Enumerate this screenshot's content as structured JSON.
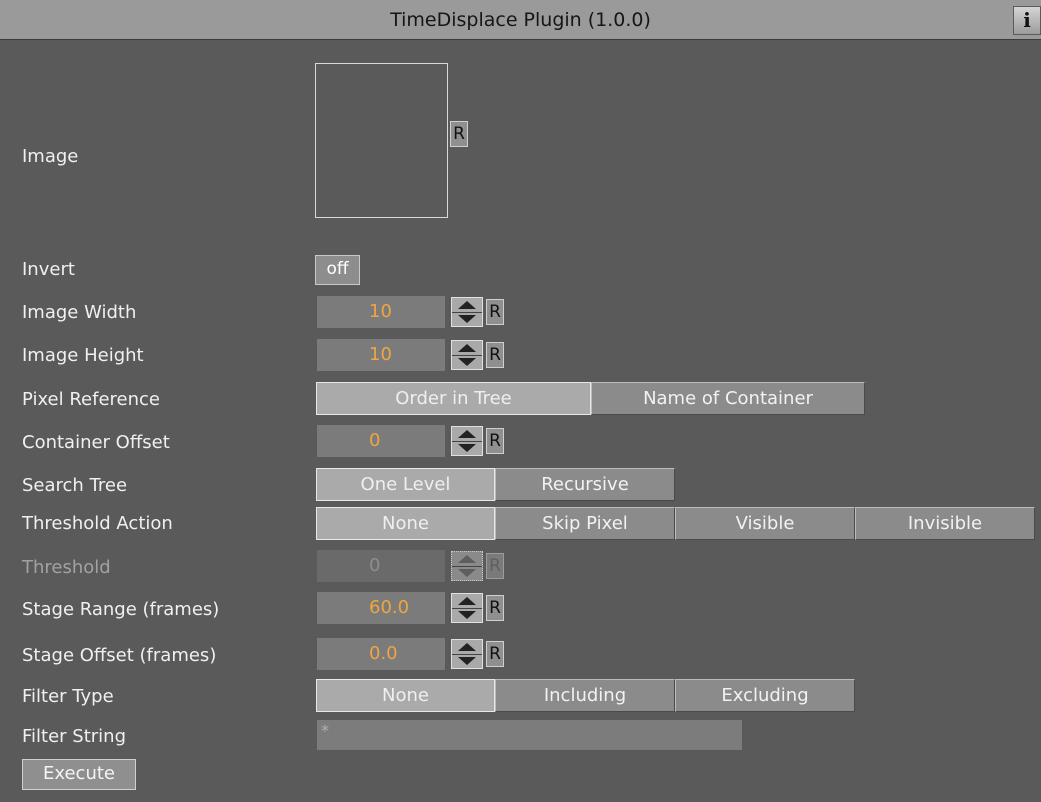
{
  "titlebar": {
    "title": "TimeDisplace Plugin (1.0.0)",
    "info_label": "i"
  },
  "labels": {
    "image": "Image",
    "invert": "Invert",
    "image_width": "Image Width",
    "image_height": "Image Height",
    "pixel_reference": "Pixel Reference",
    "container_offset": "Container Offset",
    "search_tree": "Search Tree",
    "threshold_action": "Threshold Action",
    "threshold": "Threshold",
    "stage_range": "Stage Range (frames)",
    "stage_offset": "Stage Offset (frames)",
    "filter_type": "Filter Type",
    "filter_string": "Filter String"
  },
  "reset_label": "R",
  "invert": {
    "value": "off"
  },
  "fields": {
    "image_width": "10",
    "image_height": "10",
    "container_offset": "0",
    "threshold": "0",
    "stage_range": "60.0",
    "stage_offset": "0.0"
  },
  "pixel_reference": {
    "options": [
      "Order in Tree",
      "Name of Container"
    ],
    "selected": "Order in Tree"
  },
  "search_tree": {
    "options": [
      "One Level",
      "Recursive"
    ],
    "selected": "One Level"
  },
  "threshold_action": {
    "options": [
      "None",
      "Skip Pixel",
      "Visible",
      "Invisible"
    ],
    "selected": "None"
  },
  "filter_type": {
    "options": [
      "None",
      "Including",
      "Excluding"
    ],
    "selected": "None"
  },
  "filter_string": {
    "value": "*"
  },
  "execute_label": "Execute",
  "colors": {
    "background": "#5a5a5a",
    "titlebar": "#9a9a9a",
    "value_text": "#f0a640",
    "field_bg": "#7b7b7b"
  }
}
